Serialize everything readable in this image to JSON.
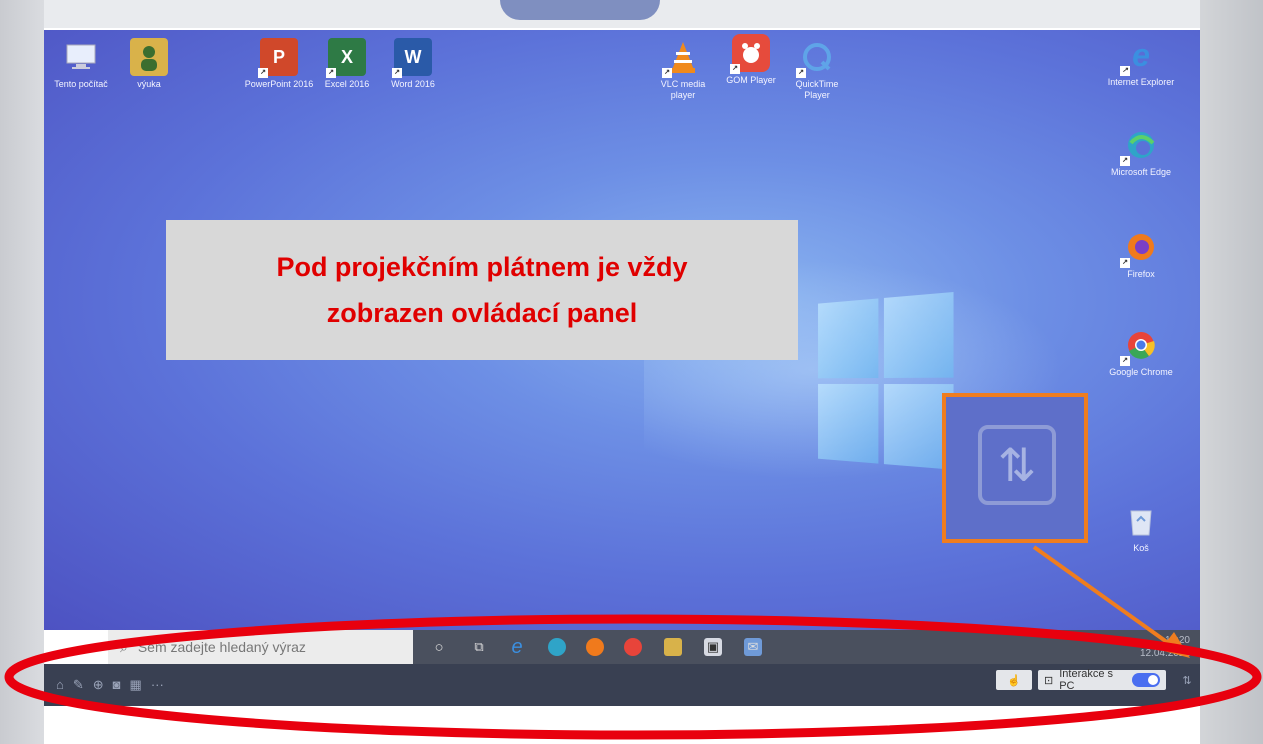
{
  "callout": {
    "line1": "Pod projekčním plátnem je vždy",
    "line2": "zobrazen ovládací panel"
  },
  "desktop_icons_left": [
    {
      "label": "Tento počítač",
      "icon": "computer-icon"
    },
    {
      "label": "výuka",
      "icon": "user-folder-icon"
    },
    {
      "label": "PowerPoint 2016",
      "icon": "powerpoint-icon",
      "glyph": "P"
    },
    {
      "label": "Excel 2016",
      "icon": "excel-icon",
      "glyph": "X"
    },
    {
      "label": "Word 2016",
      "icon": "word-icon",
      "glyph": "W"
    },
    {
      "label": "VLC media player",
      "icon": "vlc-icon"
    },
    {
      "label": "GOM Player",
      "icon": "gom-icon"
    },
    {
      "label": "QuickTime Player",
      "icon": "quicktime-icon"
    }
  ],
  "desktop_icons_right": [
    {
      "label": "Internet Explorer",
      "icon": "internet-explorer-icon",
      "glyph": "e"
    },
    {
      "label": "Microsoft Edge",
      "icon": "edge-icon"
    },
    {
      "label": "Firefox",
      "icon": "firefox-icon"
    },
    {
      "label": "Google Chrome",
      "icon": "chrome-icon"
    },
    {
      "label": "Koš",
      "icon": "recycle-bin-icon"
    }
  ],
  "taskbar": {
    "search_placeholder": "Sem zadejte hledaný výraz",
    "clock_time": "12:20",
    "clock_date": "12.04.2021"
  },
  "control_bar": {
    "interaction_label": "Interakce s PC",
    "more_label": "···"
  },
  "colors": {
    "callout_text": "#e00000",
    "highlight_border": "#ef7d1f",
    "ellipse": "#e8000e"
  }
}
